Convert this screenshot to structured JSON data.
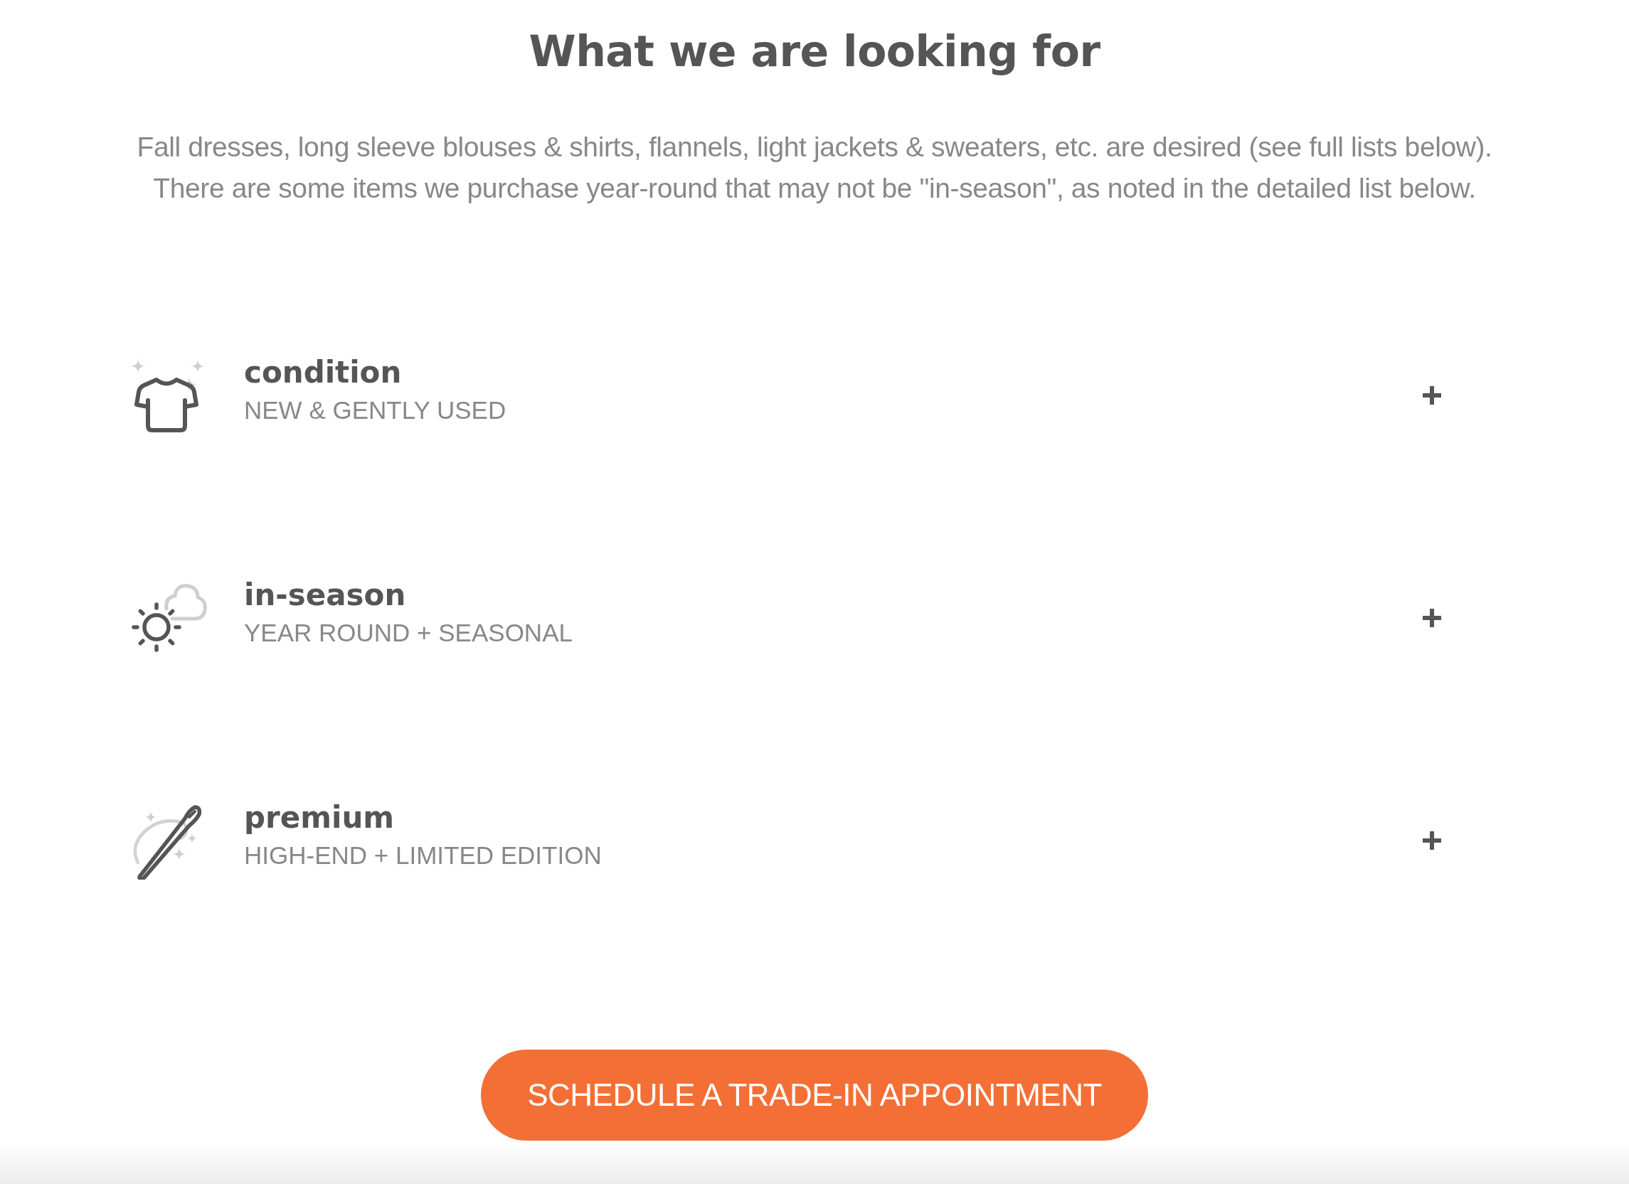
{
  "heading": "What we are looking for",
  "intro": [
    "Fall dresses, long sleeve blouses & shirts, flannels, light jackets & sweaters, etc. are desired (see full lists below).",
    "There are some items we purchase year-round that may not be \"in-season\", as noted in the detailed list below."
  ],
  "criteria": [
    {
      "title": "condition",
      "subtitle": "NEW & GENTLY USED",
      "expanded": false
    },
    {
      "title": "in-season",
      "subtitle": "YEAR ROUND + SEASONAL",
      "expanded": false
    },
    {
      "title": "premium",
      "subtitle": "HIGH-END + LIMITED EDITION",
      "expanded": false
    }
  ],
  "button": {
    "label": "SCHEDULE A TRADE-IN APPOINTMENT"
  }
}
